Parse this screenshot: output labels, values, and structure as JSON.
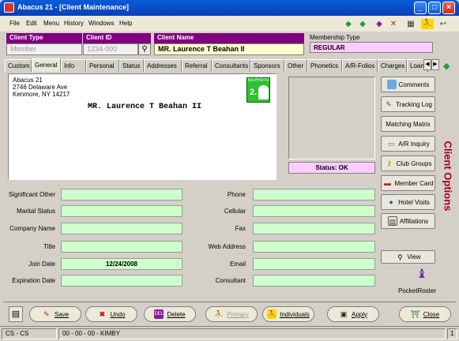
{
  "window": {
    "title": "Abacus 21 - [Client Maintenance]"
  },
  "menu": [
    "File",
    "Edit",
    "Menu",
    "History",
    "Windows",
    "Help"
  ],
  "header": {
    "client_type_label": "Client Type",
    "client_type_value": "Member",
    "client_id_label": "Client ID",
    "client_id_value": "1234-000",
    "client_name_label": "Client Name",
    "client_name_value": "MR. Laurence T Beahan II",
    "membership_type_label": "Membership Type",
    "membership_type_value": "REGULAR"
  },
  "tabs": [
    "Custom",
    "General",
    "Info",
    "Personal",
    "Status",
    "Addresses",
    "Referral",
    "Consultants",
    "Sponsors",
    "Other",
    "Phonetics",
    "A/R-Folios",
    "Charges",
    "Loan"
  ],
  "active_tab": "General",
  "address": {
    "line1": "Abacus 21",
    "line2": "2746 Delaware Ave",
    "line3": "Kenmore, NY 14217",
    "name": "MR. Laurence T Beahan II",
    "badge": "2.",
    "badge_top": "NO PHOTO"
  },
  "status": {
    "text": "Status: OK"
  },
  "side_label": "Client Options",
  "right_buttons": [
    {
      "label": "Comments",
      "icon": "comments-icon"
    },
    {
      "label": "Tracking Log",
      "icon": "pencil-icon"
    },
    {
      "label": "Matching Matrix",
      "icon": ""
    },
    {
      "label": "A/R Inquiry",
      "icon": "car-icon"
    },
    {
      "label": "Club Groups",
      "icon": "key-icon"
    },
    {
      "label": "Member Card",
      "icon": "card-icon"
    },
    {
      "label": "Hotel Visits",
      "icon": "globe-icon"
    },
    {
      "label": "Affiliations",
      "icon": "affiliations-icon"
    }
  ],
  "view_button": "View",
  "pocket_roster": "PocketRoster",
  "left_fields": [
    {
      "label": "Significant Other",
      "value": ""
    },
    {
      "label": "Marital Status",
      "value": ""
    },
    {
      "label": "Company Name",
      "value": ""
    },
    {
      "label": "Title",
      "value": ""
    },
    {
      "label": "Join Date",
      "value": "12/24/2008"
    },
    {
      "label": "Expiration Date",
      "value": ""
    }
  ],
  "right_fields": [
    {
      "label": "Phone",
      "value": ""
    },
    {
      "label": "Cellular",
      "value": ""
    },
    {
      "label": "Fax",
      "value": ""
    },
    {
      "label": "Web Address",
      "value": ""
    },
    {
      "label": "Email",
      "value": ""
    },
    {
      "label": "Consultant",
      "value": ""
    }
  ],
  "bottom_buttons": {
    "save": "Save",
    "undo": "Undo",
    "delete": "Delete",
    "primary": "Primary",
    "individuals": "Individuals",
    "apply": "Apply",
    "close": "Close"
  },
  "statusbar": {
    "left": "CS - CS",
    "middle": "00 - 00 - 00 - KIMBY",
    "right": "1"
  },
  "colors": {
    "header_purple": "#800080",
    "field_green": "#ccffcc",
    "status_pink": "#ffccff",
    "options_red": "#a0001e"
  }
}
